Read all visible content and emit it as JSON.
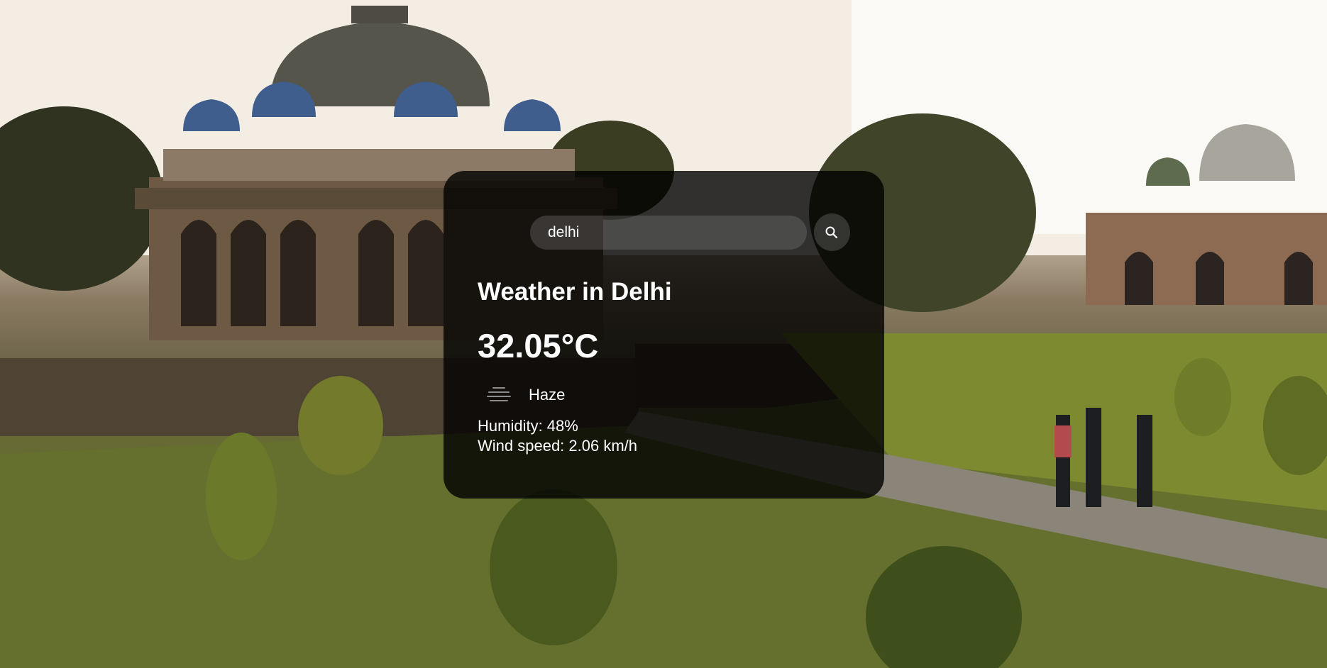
{
  "search": {
    "value": "delhi",
    "placeholder": "Search"
  },
  "weather": {
    "title": "Weather in Delhi",
    "temperature": "32.05°C",
    "description": "Haze",
    "description_icon": "haze-icon",
    "humidity": "Humidity: 48%",
    "wind": "Wind speed: 2.06 km/h"
  },
  "icons": {
    "search": "search-icon"
  }
}
